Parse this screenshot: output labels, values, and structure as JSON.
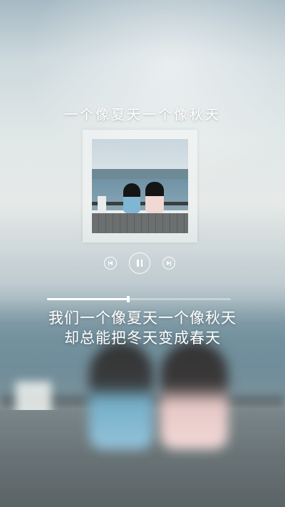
{
  "song": {
    "title": "一个像夏天一个像秋天"
  },
  "player": {
    "prev_icon": "previous-track-icon",
    "play_icon": "pause-icon",
    "next_icon": "next-track-icon",
    "progress": 0.44
  },
  "lyrics": {
    "line1": "我们一个像夏天一个像秋天",
    "line2": "却总能把冬天变成春天"
  },
  "colors": {
    "text": "#ffffff",
    "accent": "#ffffff"
  }
}
